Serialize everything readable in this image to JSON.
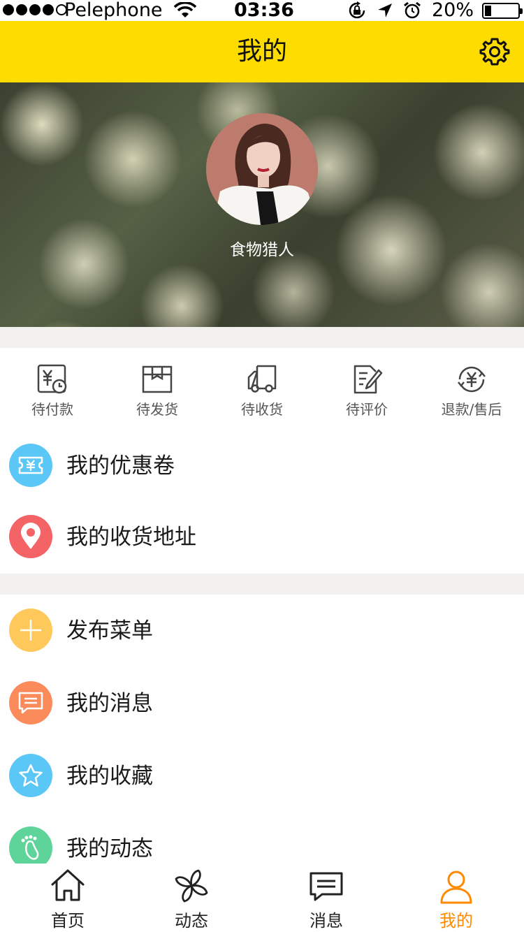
{
  "status_bar": {
    "carrier": "Pelephone",
    "time": "03:36",
    "battery_percent": "20%",
    "battery_level": 0.2
  },
  "header": {
    "title": "我的",
    "settings_icon": "gear-icon"
  },
  "profile": {
    "username": "食物猎人"
  },
  "orders": [
    {
      "label": "待付款",
      "icon": "payment-pending-icon"
    },
    {
      "label": "待发货",
      "icon": "box-icon"
    },
    {
      "label": "待收货",
      "icon": "truck-icon"
    },
    {
      "label": "待评价",
      "icon": "edit-document-icon"
    },
    {
      "label": "退款/售后",
      "icon": "refund-icon"
    }
  ],
  "menu_group_1": [
    {
      "label": "我的优惠卷",
      "icon": "coupon-icon",
      "color": "#5bc7f7"
    },
    {
      "label": "我的收货地址",
      "icon": "location-pin-icon",
      "color": "#f46366"
    }
  ],
  "menu_group_2": [
    {
      "label": "发布菜单",
      "icon": "plus-icon",
      "color": "#ffc85a"
    },
    {
      "label": "我的消息",
      "icon": "message-icon",
      "color": "#fb8b5a"
    },
    {
      "label": "我的收藏",
      "icon": "star-icon",
      "color": "#5bc7f7"
    },
    {
      "label": "我的动态",
      "icon": "footprint-icon",
      "color": "#5ed49a"
    }
  ],
  "tabs": [
    {
      "label": "首页",
      "icon": "home-icon",
      "active": false
    },
    {
      "label": "动态",
      "icon": "pinwheel-icon",
      "active": false
    },
    {
      "label": "消息",
      "icon": "chat-icon",
      "active": false
    },
    {
      "label": "我的",
      "icon": "person-icon",
      "active": true
    }
  ],
  "colors": {
    "header": "#ffdc00",
    "active_tab": "#ff8a00",
    "section_gap": "#f2f1ef"
  }
}
